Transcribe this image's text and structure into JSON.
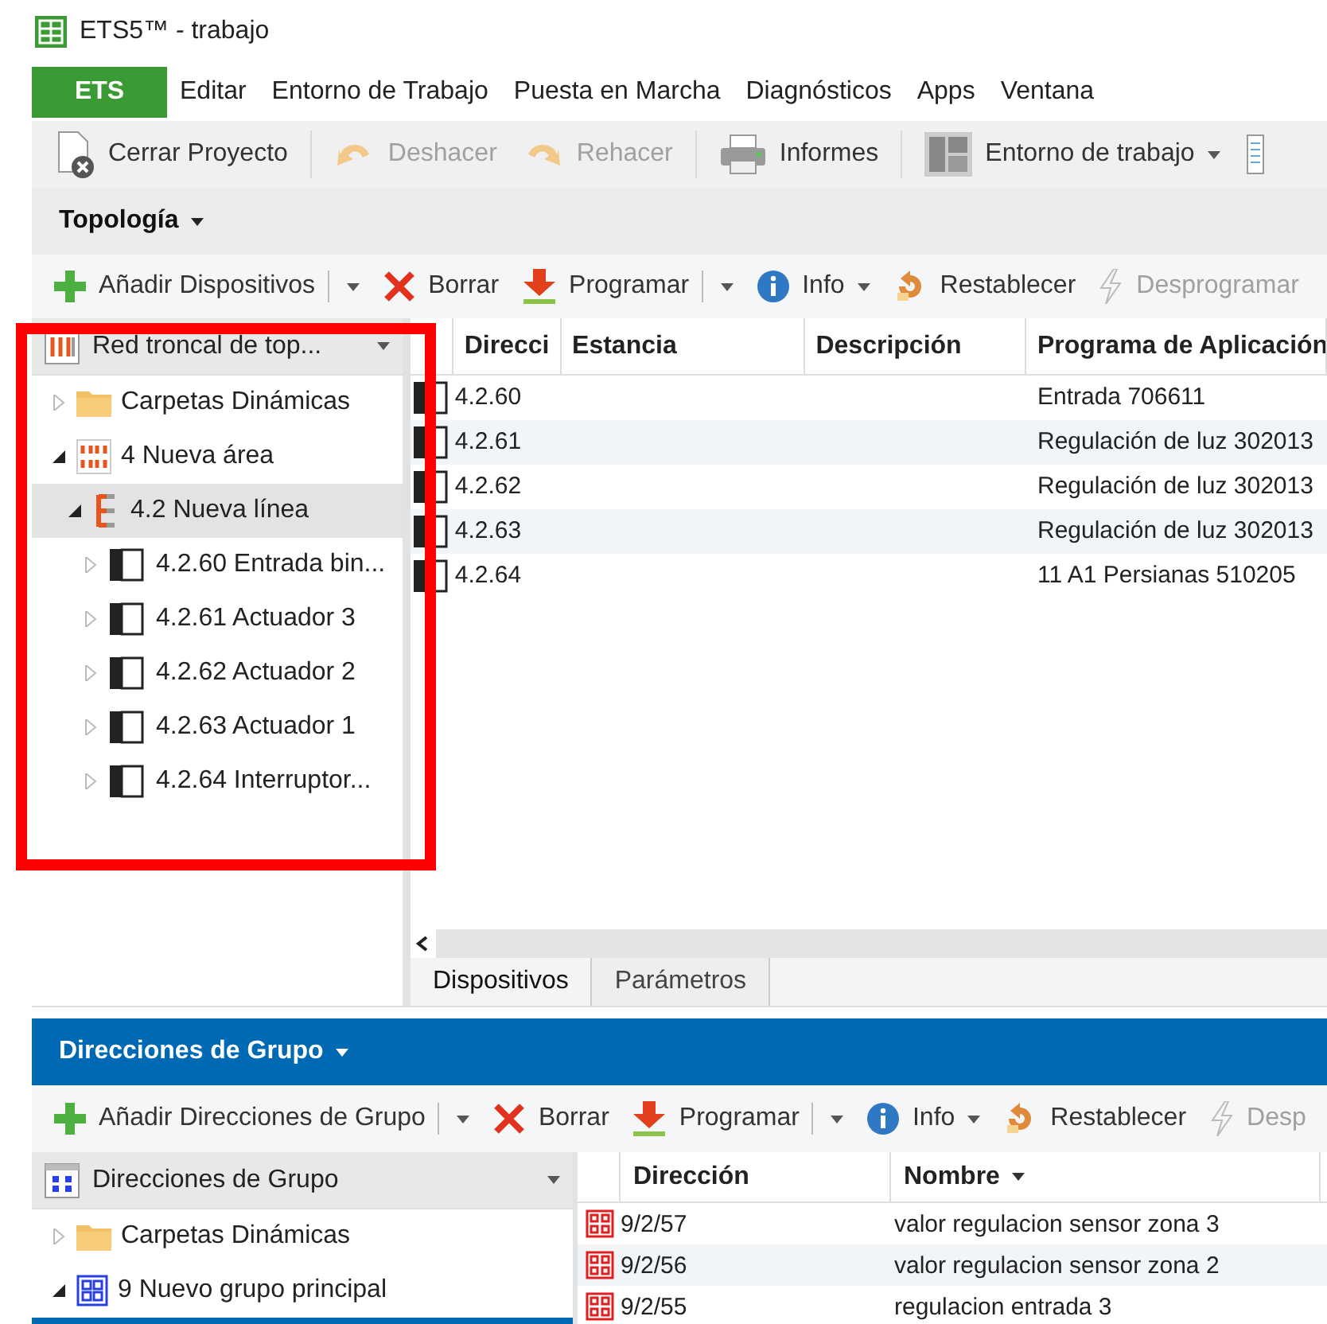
{
  "window": {
    "title": "ETS5™ - trabajo"
  },
  "menu": [
    {
      "label": "ETS",
      "kind": "app"
    },
    {
      "label": "Editar",
      "kind": "menu"
    },
    {
      "label": "Entorno de Trabajo",
      "kind": "menu"
    },
    {
      "label": "Puesta en Marcha",
      "kind": "menu"
    },
    {
      "label": "Diagnósticos",
      "kind": "menu"
    },
    {
      "label": "Apps",
      "kind": "menu"
    },
    {
      "label": "Ventana",
      "kind": "menu"
    }
  ],
  "toolbar": [
    {
      "kind": "close-project",
      "label": "Cerrar Proyecto",
      "disabled": false
    },
    {
      "kind": "separator"
    },
    {
      "kind": "undo",
      "label": "Deshacer",
      "disabled": true
    },
    {
      "kind": "redo",
      "label": "Rehacer",
      "disabled": true
    },
    {
      "kind": "separator"
    },
    {
      "kind": "printer",
      "label": "Informes",
      "disabled": false
    },
    {
      "kind": "separator"
    },
    {
      "kind": "layout",
      "label": "Entorno de trabajo",
      "disabled": false,
      "dropdown": true
    },
    {
      "kind": "list"
    }
  ],
  "topology": {
    "title": "Topología",
    "actions": [
      {
        "kind": "add",
        "label": "Añadir Dispositivos",
        "disabled": false,
        "split": true
      },
      {
        "kind": "delete",
        "label": "Borrar",
        "disabled": false
      },
      {
        "kind": "download",
        "label": "Programar",
        "disabled": false,
        "split": true
      },
      {
        "kind": "info",
        "label": "Info",
        "disabled": false,
        "dropdown": true
      },
      {
        "kind": "reset",
        "label": "Restablecer",
        "disabled": false
      },
      {
        "kind": "lightning",
        "label": "Desprogramar",
        "disabled": true
      }
    ],
    "tree_header": "Red troncal de top...",
    "tree": [
      {
        "kind": "folder",
        "label": "Carpetas Dinámicas",
        "expanded": false,
        "selected": false
      },
      {
        "kind": "area",
        "label": "4 Nueva área",
        "expanded": true,
        "selected": false,
        "children": [
          {
            "kind": "line",
            "label": "4.2 Nueva línea",
            "expanded": true,
            "selected": true,
            "children": [
              {
                "kind": "device",
                "label": "4.2.60 Entrada bin...",
                "expanded": false,
                "selected": false
              },
              {
                "kind": "device",
                "label": "4.2.61 Actuador 3",
                "expanded": false,
                "selected": false
              },
              {
                "kind": "device",
                "label": "4.2.62 Actuador 2",
                "expanded": false,
                "selected": false
              },
              {
                "kind": "device",
                "label": "4.2.63 Actuador 1",
                "expanded": false,
                "selected": false
              },
              {
                "kind": "device",
                "label": "4.2.64 Interruptor...",
                "expanded": false,
                "selected": false
              }
            ]
          }
        ]
      }
    ],
    "table": {
      "columns": [
        "Direcci",
        "Estancia",
        "Descripción",
        "Programa de Aplicación"
      ],
      "rows": [
        [
          "4.2.60",
          "",
          "",
          "Entrada 706611"
        ],
        [
          "4.2.61",
          "",
          "",
          "Regulación de luz 302013"
        ],
        [
          "4.2.62",
          "",
          "",
          "Regulación de luz 302013"
        ],
        [
          "4.2.63",
          "",
          "",
          "Regulación de luz 302013"
        ],
        [
          "4.2.64",
          "",
          "",
          "11 A1 Persianas  510205"
        ]
      ]
    },
    "tabs": [
      {
        "label": "Dispositivos",
        "selected": true
      },
      {
        "label": "Parámetros",
        "selected": false
      }
    ]
  },
  "group_addresses": {
    "title": "Direcciones de Grupo",
    "actions": [
      {
        "kind": "add",
        "label": "Añadir Direcciones de Grupo",
        "disabled": false,
        "split": true
      },
      {
        "kind": "delete",
        "label": "Borrar",
        "disabled": false
      },
      {
        "kind": "download",
        "label": "Programar",
        "disabled": false,
        "split": true
      },
      {
        "kind": "info",
        "label": "Info",
        "disabled": false,
        "dropdown": true
      },
      {
        "kind": "reset",
        "label": "Restablecer",
        "disabled": false
      },
      {
        "kind": "lightning",
        "label": "Desp",
        "disabled": true
      }
    ],
    "tree_header": "Direcciones de Grupo",
    "tree": [
      {
        "kind": "folder",
        "label": "Carpetas Dinámicas",
        "expanded": false,
        "selected": false
      },
      {
        "kind": "group",
        "label": "9 Nuevo grupo principal",
        "expanded": true,
        "selected": false,
        "children": [
          {
            "selected": true
          }
        ]
      }
    ],
    "table": {
      "columns": [
        "Dirección",
        "Nombre"
      ],
      "rows": [
        [
          "9/2/57",
          "valor regulacion sensor zona 3"
        ],
        [
          "9/2/56",
          "valor regulacion sensor zona 2"
        ],
        [
          "9/2/55",
          "regulacion entrada 3"
        ]
      ]
    }
  }
}
